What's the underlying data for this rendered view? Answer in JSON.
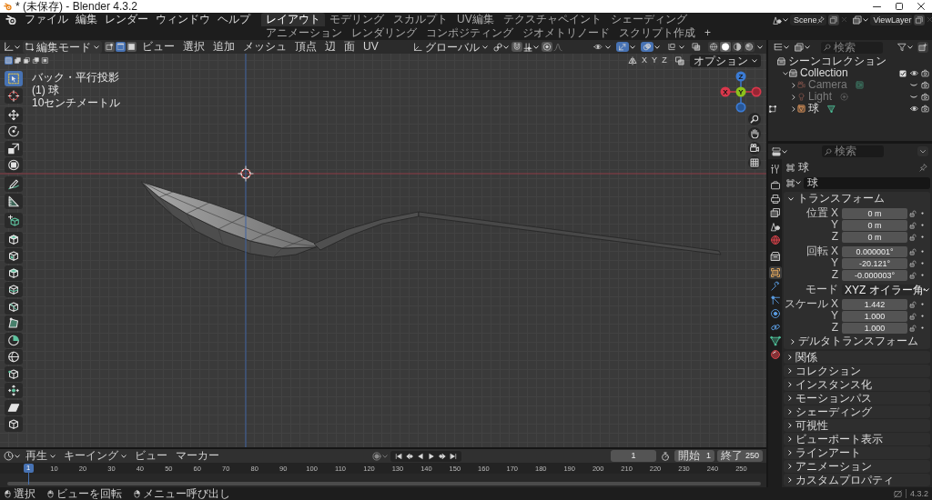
{
  "window": {
    "title": "* (未保存) - Blender 4.3.2"
  },
  "top_bar": {
    "menus": [
      "ファイル",
      "編集",
      "レンダー",
      "ウィンドウ",
      "ヘルプ"
    ],
    "workspaces": [
      {
        "label": "レイアウト",
        "selected": true
      },
      {
        "label": "モデリング",
        "selected": false
      },
      {
        "label": "スカルプト",
        "selected": false
      },
      {
        "label": "UV編集",
        "selected": false
      },
      {
        "label": "テクスチャペイント",
        "selected": false
      },
      {
        "label": "シェーディング",
        "selected": false
      },
      {
        "label": "アニメーション",
        "selected": false
      },
      {
        "label": "レンダリング",
        "selected": false
      },
      {
        "label": "コンポジティング",
        "selected": false
      },
      {
        "label": "ジオメトリノード",
        "selected": false
      },
      {
        "label": "スクリプト作成",
        "selected": false
      }
    ],
    "add_workspace": "+",
    "scene": "Scene",
    "view_layer": "ViewLayer"
  },
  "viewport_header": {
    "mode": "編集モード",
    "select_modes": [
      {
        "kind": "vertex",
        "selected": false
      },
      {
        "kind": "edge",
        "selected": true
      },
      {
        "kind": "face",
        "selected": false
      }
    ],
    "menus": [
      "ビュー",
      "選択",
      "追加",
      "メッシュ",
      "頂点",
      "辺",
      "面",
      "UV"
    ],
    "orientation": "グローバル",
    "view_toggles": [
      {
        "kind": "visibility",
        "on": false
      },
      {
        "kind": "gizmos",
        "on": true
      },
      {
        "kind": "overlays",
        "on": true
      },
      {
        "kind": "mesh_overlays",
        "on": false
      },
      {
        "kind": "xray",
        "on": false
      }
    ],
    "shading_modes": [
      {
        "kind": "wireframe",
        "selected": false
      },
      {
        "kind": "solid",
        "selected": true
      },
      {
        "kind": "material",
        "selected": false
      },
      {
        "kind": "rendered",
        "selected": false
      }
    ]
  },
  "tool_settings": {
    "selection_modes": [
      {
        "kind": "set",
        "selected": true
      },
      {
        "kind": "extend",
        "selected": false
      },
      {
        "kind": "subtract",
        "selected": false
      },
      {
        "kind": "invert",
        "selected": false
      },
      {
        "kind": "intersect",
        "selected": false
      }
    ],
    "mirror_axes": [
      {
        "label": "X",
        "selected": false
      },
      {
        "label": "Y",
        "selected": false
      },
      {
        "label": "Z",
        "selected": false
      }
    ],
    "options": "オプション"
  },
  "viewport": {
    "info": [
      "バック・平行投影",
      "(1) 球",
      "10センチメートル"
    ],
    "tool_groups": [
      {
        "tools": [
          {
            "kind": "select_box",
            "selected": true
          },
          {
            "kind": "cursor",
            "selected": false
          }
        ]
      },
      {
        "tools": [
          {
            "kind": "move",
            "selected": false
          },
          {
            "kind": "rotate",
            "selected": false
          },
          {
            "kind": "scale",
            "selected": false
          },
          {
            "kind": "transform",
            "selected": false
          }
        ]
      },
      {
        "tools": [
          {
            "kind": "annotate",
            "selected": false
          },
          {
            "kind": "measure",
            "selected": false
          }
        ]
      },
      {
        "tools": [
          {
            "kind": "add_cube",
            "selected": false
          }
        ]
      },
      {
        "tools": [
          {
            "kind": "extrude",
            "selected": false
          },
          {
            "kind": "inset",
            "selected": false
          },
          {
            "kind": "bevel",
            "selected": false
          },
          {
            "kind": "loop_cut",
            "selected": false
          },
          {
            "kind": "knife",
            "selected": false
          },
          {
            "kind": "poly_build",
            "selected": false
          },
          {
            "kind": "spin",
            "selected": false
          },
          {
            "kind": "smooth",
            "selected": false
          },
          {
            "kind": "edge_slide",
            "selected": false
          },
          {
            "kind": "shrink_fatten",
            "selected": false
          },
          {
            "kind": "shear",
            "selected": false
          },
          {
            "kind": "rip",
            "selected": false
          }
        ]
      }
    ],
    "navigation_gizmo": {
      "axes": [
        {
          "kind": "z",
          "label": "Z",
          "color": "#3b7bd4"
        },
        {
          "kind": "x",
          "label": "X",
          "color": "#d9374b"
        },
        {
          "kind": "y",
          "label": "Y",
          "color": "#8cc21c"
        }
      ]
    }
  },
  "timeline": {
    "menus": [
      {
        "kind": "dropdown",
        "label": "再生"
      },
      {
        "kind": "dropdown",
        "label": "キーイング"
      },
      {
        "kind": "plain",
        "label": "ビュー"
      },
      {
        "kind": "plain",
        "label": "マーカー"
      }
    ],
    "current_frame": "1",
    "start_label": "開始",
    "start": "1",
    "end_label": "終了",
    "end": "250",
    "playhead": "1",
    "ruler": [
      "10",
      "20",
      "30",
      "40",
      "50",
      "60",
      "70",
      "80",
      "90",
      "100",
      "110",
      "120",
      "130",
      "140",
      "150",
      "160",
      "170",
      "180",
      "190",
      "200",
      "210",
      "220",
      "230",
      "240",
      "250"
    ]
  },
  "outliner": {
    "search_placeholder": "検索",
    "tree": [
      {
        "kind": "scene_collection",
        "label": "シーンコレクション",
        "children": [
          {
            "kind": "collection",
            "label": "Collection",
            "expanded": true,
            "checked": true,
            "visible": true,
            "children": [
              {
                "kind": "camera",
                "label": "Camera",
                "expanded": false,
                "visible": false,
                "edit_mode": false
              },
              {
                "kind": "light",
                "label": "Light",
                "expanded": false,
                "visible": false,
                "edit_mode": false
              },
              {
                "kind": "mesh",
                "label": "球",
                "expanded": false,
                "visible": true,
                "edit_mode": true
              }
            ]
          }
        ]
      }
    ]
  },
  "properties": {
    "search_placeholder": "検索",
    "tab_groups": [
      {
        "tabs": [
          {
            "kind": "tool",
            "selected": false
          }
        ]
      },
      {
        "tabs": [
          {
            "kind": "render",
            "selected": false
          },
          {
            "kind": "output",
            "selected": false
          },
          {
            "kind": "view_layer",
            "selected": false
          },
          {
            "kind": "scene",
            "selected": false
          },
          {
            "kind": "world",
            "selected": false
          }
        ]
      },
      {
        "tabs": [
          {
            "kind": "collection",
            "selected": false
          }
        ]
      },
      {
        "tabs": [
          {
            "kind": "object",
            "selected": true
          },
          {
            "kind": "modifiers",
            "selected": false
          },
          {
            "kind": "particles",
            "selected": false
          },
          {
            "kind": "physics",
            "selected": false
          },
          {
            "kind": "constraints",
            "selected": false
          },
          {
            "kind": "data",
            "selected": false
          },
          {
            "kind": "material",
            "selected": false
          }
        ]
      }
    ],
    "context": "球",
    "name": "球",
    "transform": {
      "label": "トランスフォーム",
      "expanded": true,
      "groups": [
        {
          "rows": [
            {
              "kind": "number",
              "label": "位置 X",
              "value": "0 m",
              "locked": false
            },
            {
              "kind": "number",
              "label": "Y",
              "value": "0 m",
              "locked": false
            },
            {
              "kind": "number",
              "label": "Z",
              "value": "0 m",
              "locked": false
            }
          ]
        },
        {
          "rows": [
            {
              "kind": "number",
              "label": "回転 X",
              "value": "0.000001°",
              "locked": false
            },
            {
              "kind": "number",
              "label": "Y",
              "value": "-20.121°",
              "locked": false
            },
            {
              "kind": "number",
              "label": "Z",
              "value": "-0.000003°",
              "locked": false
            }
          ]
        },
        {
          "rows": [
            {
              "kind": "dropdown",
              "label": "モード",
              "value": "XYZ オイラー角"
            }
          ]
        },
        {
          "rows": [
            {
              "kind": "number",
              "label": "スケール X",
              "value": "1.442",
              "locked": false
            },
            {
              "kind": "number",
              "label": "Y",
              "value": "1.000",
              "locked": false
            },
            {
              "kind": "number",
              "label": "Z",
              "value": "1.000",
              "locked": false
            }
          ]
        }
      ],
      "delta": {
        "label": "デルタトランスフォーム",
        "expanded": false
      }
    },
    "panels": [
      {
        "label": "関係",
        "expanded": false
      },
      {
        "label": "コレクション",
        "expanded": false
      },
      {
        "label": "インスタンス化",
        "expanded": false
      },
      {
        "label": "モーションパス",
        "expanded": false
      },
      {
        "label": "シェーディング",
        "expanded": false
      },
      {
        "label": "可視性",
        "expanded": false
      },
      {
        "label": "ビューポート表示",
        "expanded": false
      },
      {
        "label": "ラインアート",
        "expanded": false
      },
      {
        "label": "アニメーション",
        "expanded": false
      },
      {
        "label": "カスタムプロパティ",
        "expanded": false
      }
    ]
  },
  "status_bar": {
    "hints": [
      {
        "kind": "left_click",
        "label": "選択"
      },
      {
        "kind": "middle_click",
        "label": "ビューを回転"
      },
      {
        "kind": "right_click",
        "label": "メニュー呼び出し"
      }
    ],
    "version": "4.3.2"
  }
}
